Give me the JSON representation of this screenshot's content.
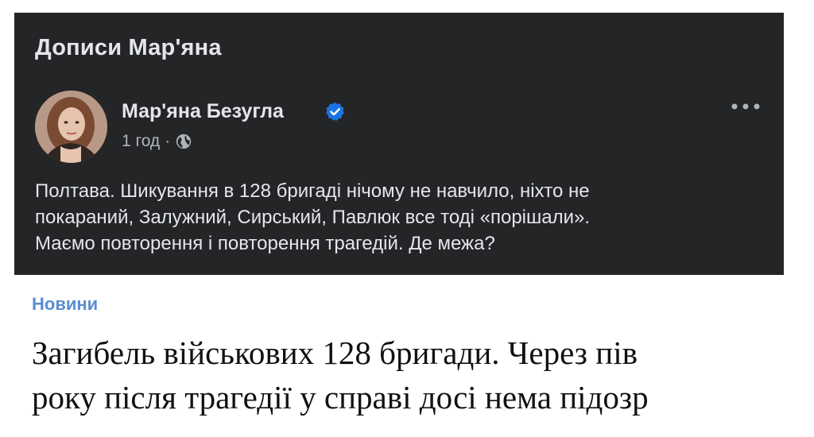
{
  "post": {
    "section_title": "Дописи Мар'яна",
    "author_name": "Мар'яна Безугла",
    "time": "1 год",
    "separator": "·",
    "text": "Полтава. Шикування в 128 бригаді нічому не навчило, ніхто не\nпокараний, Залужний, Сирський, Павлюк все тоді «порішали».\nМаємо повторення і повторення трагедій. Де межа?",
    "icons": {
      "verified": "verified-badge-icon",
      "audience": "globe-icon",
      "more": "more-options-icon"
    },
    "colors": {
      "card_bg": "#242526",
      "text": "#e4e6eb",
      "meta": "#b0b3b8",
      "verified": "#1b74e4"
    }
  },
  "article": {
    "category": "Новини",
    "headline": "Загибель військових 128 бригади. Через пів\nроку після трагедії у справі досі нема підозр",
    "colors": {
      "category": "#5b8ccf",
      "headline": "#111111"
    }
  }
}
